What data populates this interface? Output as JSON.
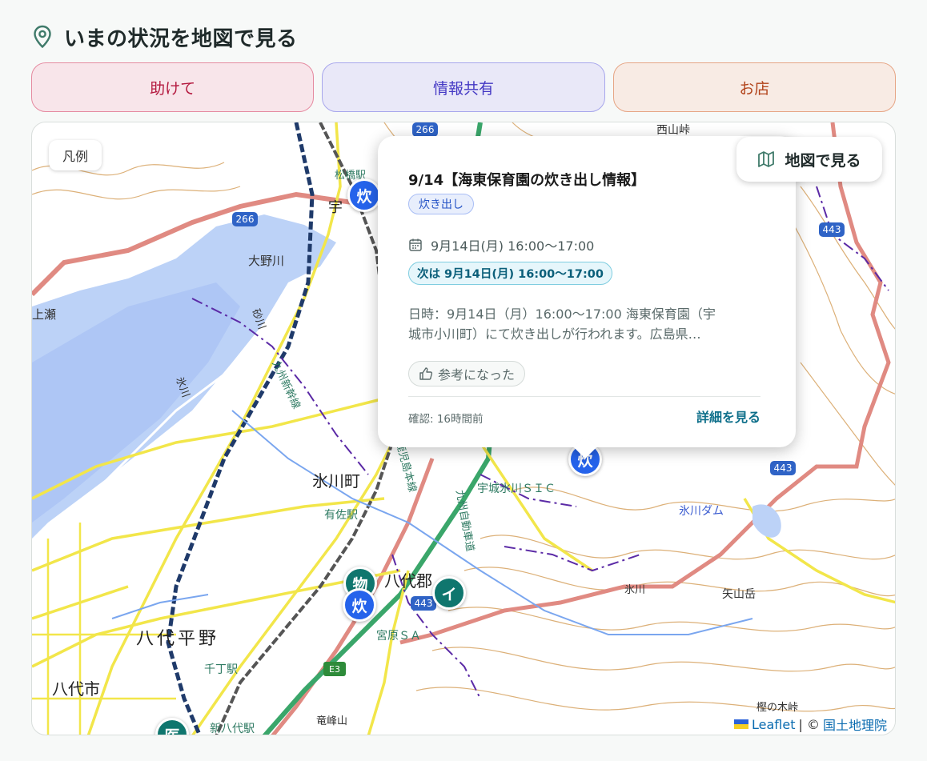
{
  "header": {
    "title": "いまの状況を地図で見る",
    "icon": "map-pin-icon"
  },
  "tabs": [
    {
      "label": "助けて",
      "color": "#b4193f"
    },
    {
      "label": "情報共有",
      "color": "#4438c4"
    },
    {
      "label": "お店",
      "color": "#b2431a"
    }
  ],
  "map": {
    "legend_label": "凡例",
    "view_map_label": "地図で見る",
    "place_labels": {
      "hikawa_town": "氷川町",
      "yatsushiro_plain": "八代平野",
      "yatsushiro_city": "八代市",
      "yatsushiro_gun": "八代郡",
      "oono_river": "大野川",
      "kamise": "上瀬",
      "arisa_station": "有佐駅",
      "senchou_station": "千丁駅",
      "shin_yatsushiro_station": "新八代駅",
      "uki_hikawa_sic": "宇城氷川ＳＩＣ",
      "hikawa_dam": "氷川ダム",
      "yayama": "矢山岳",
      "miyahara_sa": "宮原ＳＡ",
      "tatsumine": "竜峰山",
      "nishiyama": "西山峠",
      "kashi": "樫の木峠",
      "matsubase_station": "松橋駅",
      "uki": "宇",
      "kyushu_shinkansen": "九州新幹線",
      "kyushu_expressway": "九州自動車道",
      "kagoshima_line": "鹿児島本線",
      "hikawa_river": "氷川",
      "hikawa_river2": "氷川",
      "sunagawa": "砂川",
      "route_266a": "266",
      "route_266b": "266",
      "route_443a": "443",
      "route_443b": "443",
      "route_443c": "443",
      "e3": "E3"
    },
    "markers": [
      {
        "label": "炊",
        "type": "blue"
      },
      {
        "label": "炊",
        "type": "blue"
      },
      {
        "label": "物",
        "type": "green"
      },
      {
        "label": "炊",
        "type": "blue"
      },
      {
        "label": "イ",
        "type": "green"
      },
      {
        "label": "医",
        "type": "green"
      }
    ],
    "attribution": {
      "leaflet": "Leaflet",
      "separator": "| ©",
      "source": "国土地理院"
    }
  },
  "popup": {
    "title": "9/14【海東保育園の炊き出し情報】",
    "tag": "炊き出し",
    "date": "9月14日(月) 16:00～17:00",
    "next": "次は 9月14日(月) 16:00～17:00",
    "description_line1": "日時：9月14日（月）16:00～17:00 海東保育園（宇",
    "description_line2": "城市小川町）にて炊き出しが行われます。広島県…",
    "like_label": "参考になった",
    "confirmed": "確認: 16時間前",
    "detail_label": "詳細を見る"
  }
}
